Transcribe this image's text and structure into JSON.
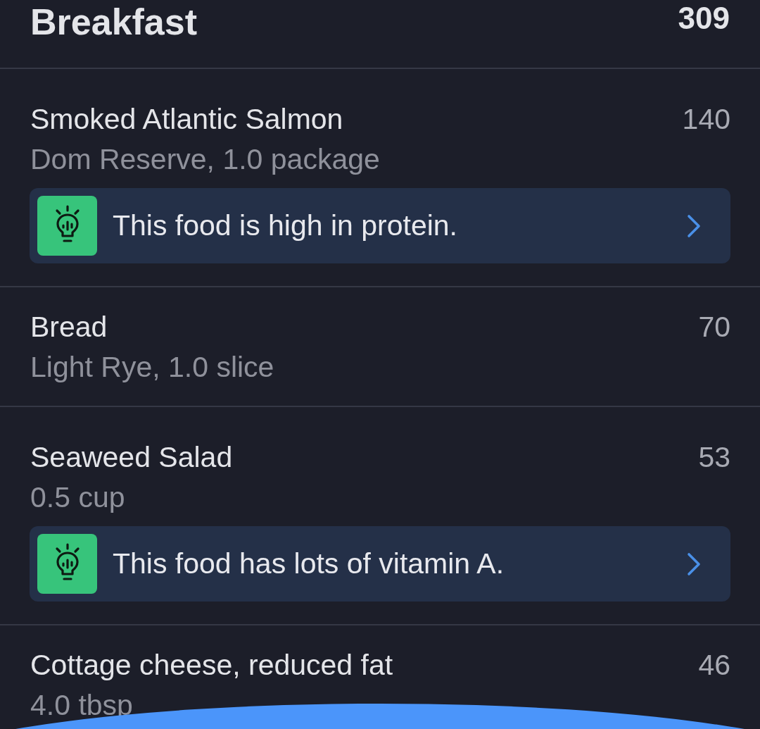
{
  "meal": {
    "title": "Breakfast",
    "calories": "309"
  },
  "foods": [
    {
      "name": "Smoked Atlantic Salmon",
      "detail": "Dom Reserve, 1.0 package",
      "calories": "140",
      "tip": "This food is high in protein."
    },
    {
      "name": "Bread",
      "detail": "Light Rye, 1.0 slice",
      "calories": "70"
    },
    {
      "name": "Seaweed Salad",
      "detail": "0.5 cup",
      "calories": "53",
      "tip": "This food has lots of vitamin A."
    },
    {
      "name": "Cottage cheese, reduced fat",
      "detail": "4.0 tbsp",
      "calories": "46"
    }
  ]
}
